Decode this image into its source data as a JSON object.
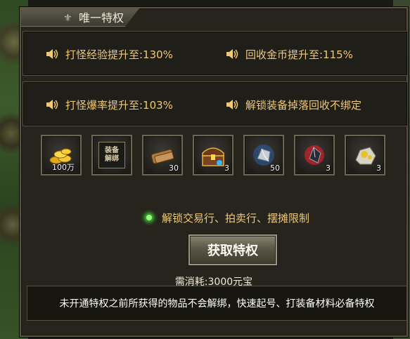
{
  "window": {
    "title": "唯一特权"
  },
  "perks": {
    "row1": [
      {
        "text": "打怪经验提升至:130%"
      },
      {
        "text": "回收金币提升至:115%"
      }
    ],
    "row2": [
      {
        "text": "打怪爆率提升至:103%"
      },
      {
        "text": "解锁装备掉落回收不绑定"
      }
    ]
  },
  "items": [
    {
      "icon": "gold-coins-icon",
      "qty": "100万"
    },
    {
      "icon": "equip-unbind-scroll-icon",
      "label": "装备解绑",
      "qty": ""
    },
    {
      "icon": "scroll-bundle-icon",
      "qty": "30"
    },
    {
      "icon": "treasure-chest-icon",
      "qty": "3"
    },
    {
      "icon": "silver-stone-icon",
      "qty": "50"
    },
    {
      "icon": "red-crystal-icon",
      "qty": "3"
    },
    {
      "icon": "gold-ore-icon",
      "qty": "3"
    }
  ],
  "unlock": {
    "text": "解锁交易行、拍卖行、摆摊限制"
  },
  "button": {
    "label": "获取特权"
  },
  "cost": {
    "text": "需消耗:3000元宝"
  },
  "notice": {
    "text": "未开通特权之前所获得的物品不会解绑，快速起号、打装备材料必备特权"
  },
  "colors": {
    "perk_text": "#efc978",
    "frame_border": "#5b5544",
    "background": "#26241d"
  }
}
